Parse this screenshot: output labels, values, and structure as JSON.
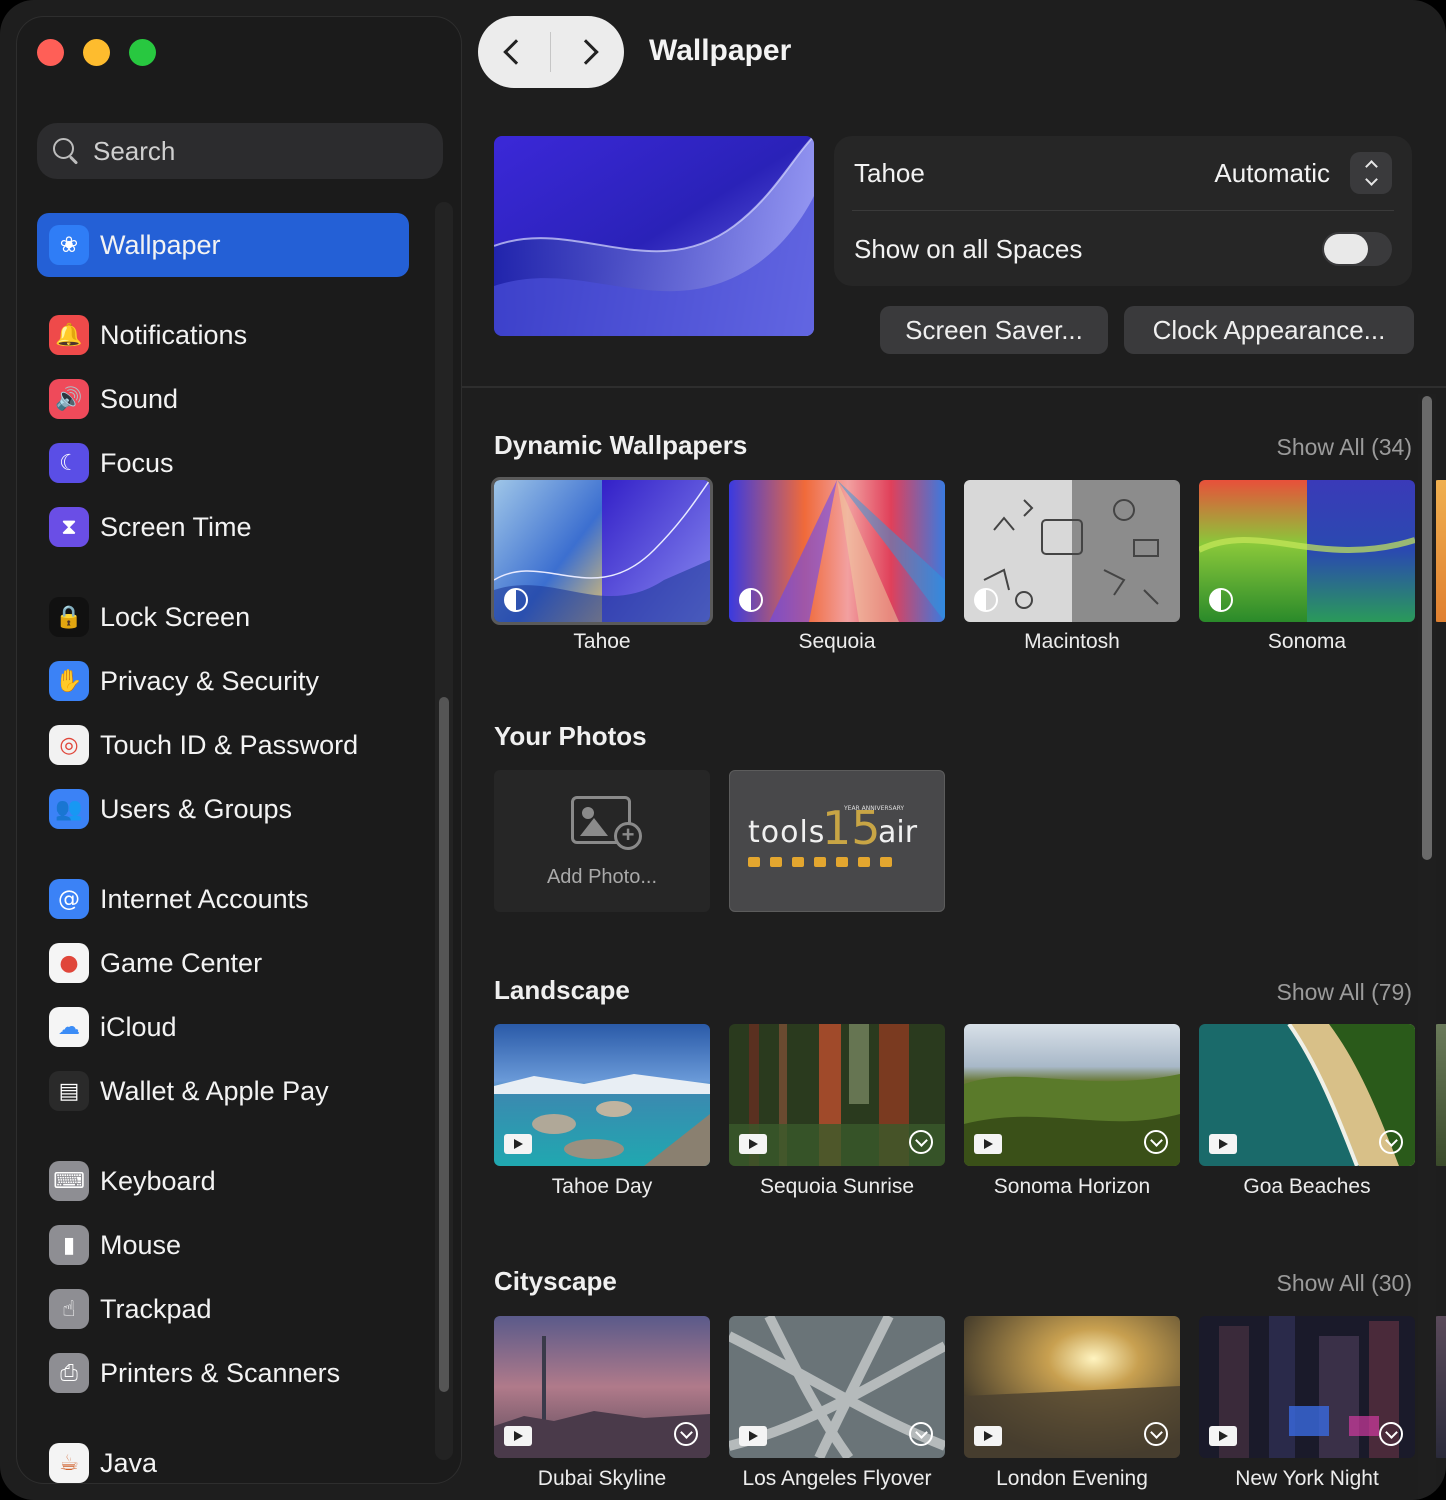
{
  "sidebar": {
    "search_placeholder": "Search",
    "items": [
      {
        "label": "Wallpaper",
        "icon": "wallpaper-icon",
        "color": "#2f7df6",
        "glyph": "❀",
        "active": true,
        "top": 0
      },
      {
        "label": "Notifications",
        "icon": "notifications-icon",
        "color": "#ef4a4a",
        "glyph": "🔔"
      },
      {
        "label": "Sound",
        "icon": "sound-icon",
        "color": "#ef4a5a",
        "glyph": "🔊"
      },
      {
        "label": "Focus",
        "icon": "focus-icon",
        "color": "#5a4ee6",
        "glyph": "☾"
      },
      {
        "label": "Screen Time",
        "icon": "screen-time-icon",
        "color": "#6a4ee6",
        "glyph": "⧗"
      },
      {
        "label": "Lock Screen",
        "icon": "lock-screen-icon",
        "color": "#111111",
        "glyph": "🔒"
      },
      {
        "label": "Privacy & Security",
        "icon": "privacy-hand-icon",
        "color": "#3b82f6",
        "glyph": "✋"
      },
      {
        "label": "Touch ID & Password",
        "icon": "fingerprint-icon",
        "color": "#f2f2f2",
        "glyph": "◎"
      },
      {
        "label": "Users & Groups",
        "icon": "users-icon",
        "color": "#3b82f6",
        "glyph": "👥"
      },
      {
        "label": "Internet Accounts",
        "icon": "at-sign-icon",
        "color": "#3b82f6",
        "glyph": "@"
      },
      {
        "label": "Game Center",
        "icon": "game-center-icon",
        "color": "#f5f5f5",
        "glyph": "●"
      },
      {
        "label": "iCloud",
        "icon": "icloud-icon",
        "color": "#f5f5f5",
        "glyph": "☁"
      },
      {
        "label": "Wallet & Apple Pay",
        "icon": "wallet-icon",
        "color": "#2a2a2a",
        "glyph": "▤"
      },
      {
        "label": "Keyboard",
        "icon": "keyboard-icon",
        "color": "#8e8e93",
        "glyph": "⌨"
      },
      {
        "label": "Mouse",
        "icon": "mouse-icon",
        "color": "#8e8e93",
        "glyph": "▮"
      },
      {
        "label": "Trackpad",
        "icon": "trackpad-icon",
        "color": "#8e8e93",
        "glyph": "☝"
      },
      {
        "label": "Printers & Scanners",
        "icon": "printer-icon",
        "color": "#8e8e93",
        "glyph": "⎙"
      },
      {
        "label": "Java",
        "icon": "java-icon",
        "color": "#f4f4f4",
        "glyph": "☕"
      }
    ]
  },
  "header": {
    "title": "Wallpaper"
  },
  "settings": {
    "wallpaper_name": "Tahoe",
    "mode_value": "Automatic",
    "show_all_spaces_label": "Show on all Spaces",
    "show_all_spaces_on": false,
    "screen_saver_button": "Screen Saver...",
    "clock_appearance_button": "Clock Appearance..."
  },
  "sections": {
    "dynamic": {
      "title": "Dynamic Wallpapers",
      "show_all": "Show All (34)",
      "items": [
        "Tahoe",
        "Sequoia",
        "Macintosh",
        "Sonoma"
      ]
    },
    "photos": {
      "title": "Your Photos",
      "add_label": "Add Photo...",
      "logo_word_left": "tools",
      "logo_number": "15",
      "logo_small": "YEAR ANNIVERSARY",
      "logo_word_right": "air"
    },
    "landscape": {
      "title": "Landscape",
      "show_all": "Show All (79)",
      "items": [
        "Tahoe Day",
        "Sequoia Sunrise",
        "Sonoma Horizon",
        "Goa Beaches"
      ]
    },
    "cityscape": {
      "title": "Cityscape",
      "show_all": "Show All (30)",
      "items": [
        "Dubai Skyline",
        "Los Angeles Flyover",
        "London Evening",
        "New York Night"
      ]
    }
  }
}
